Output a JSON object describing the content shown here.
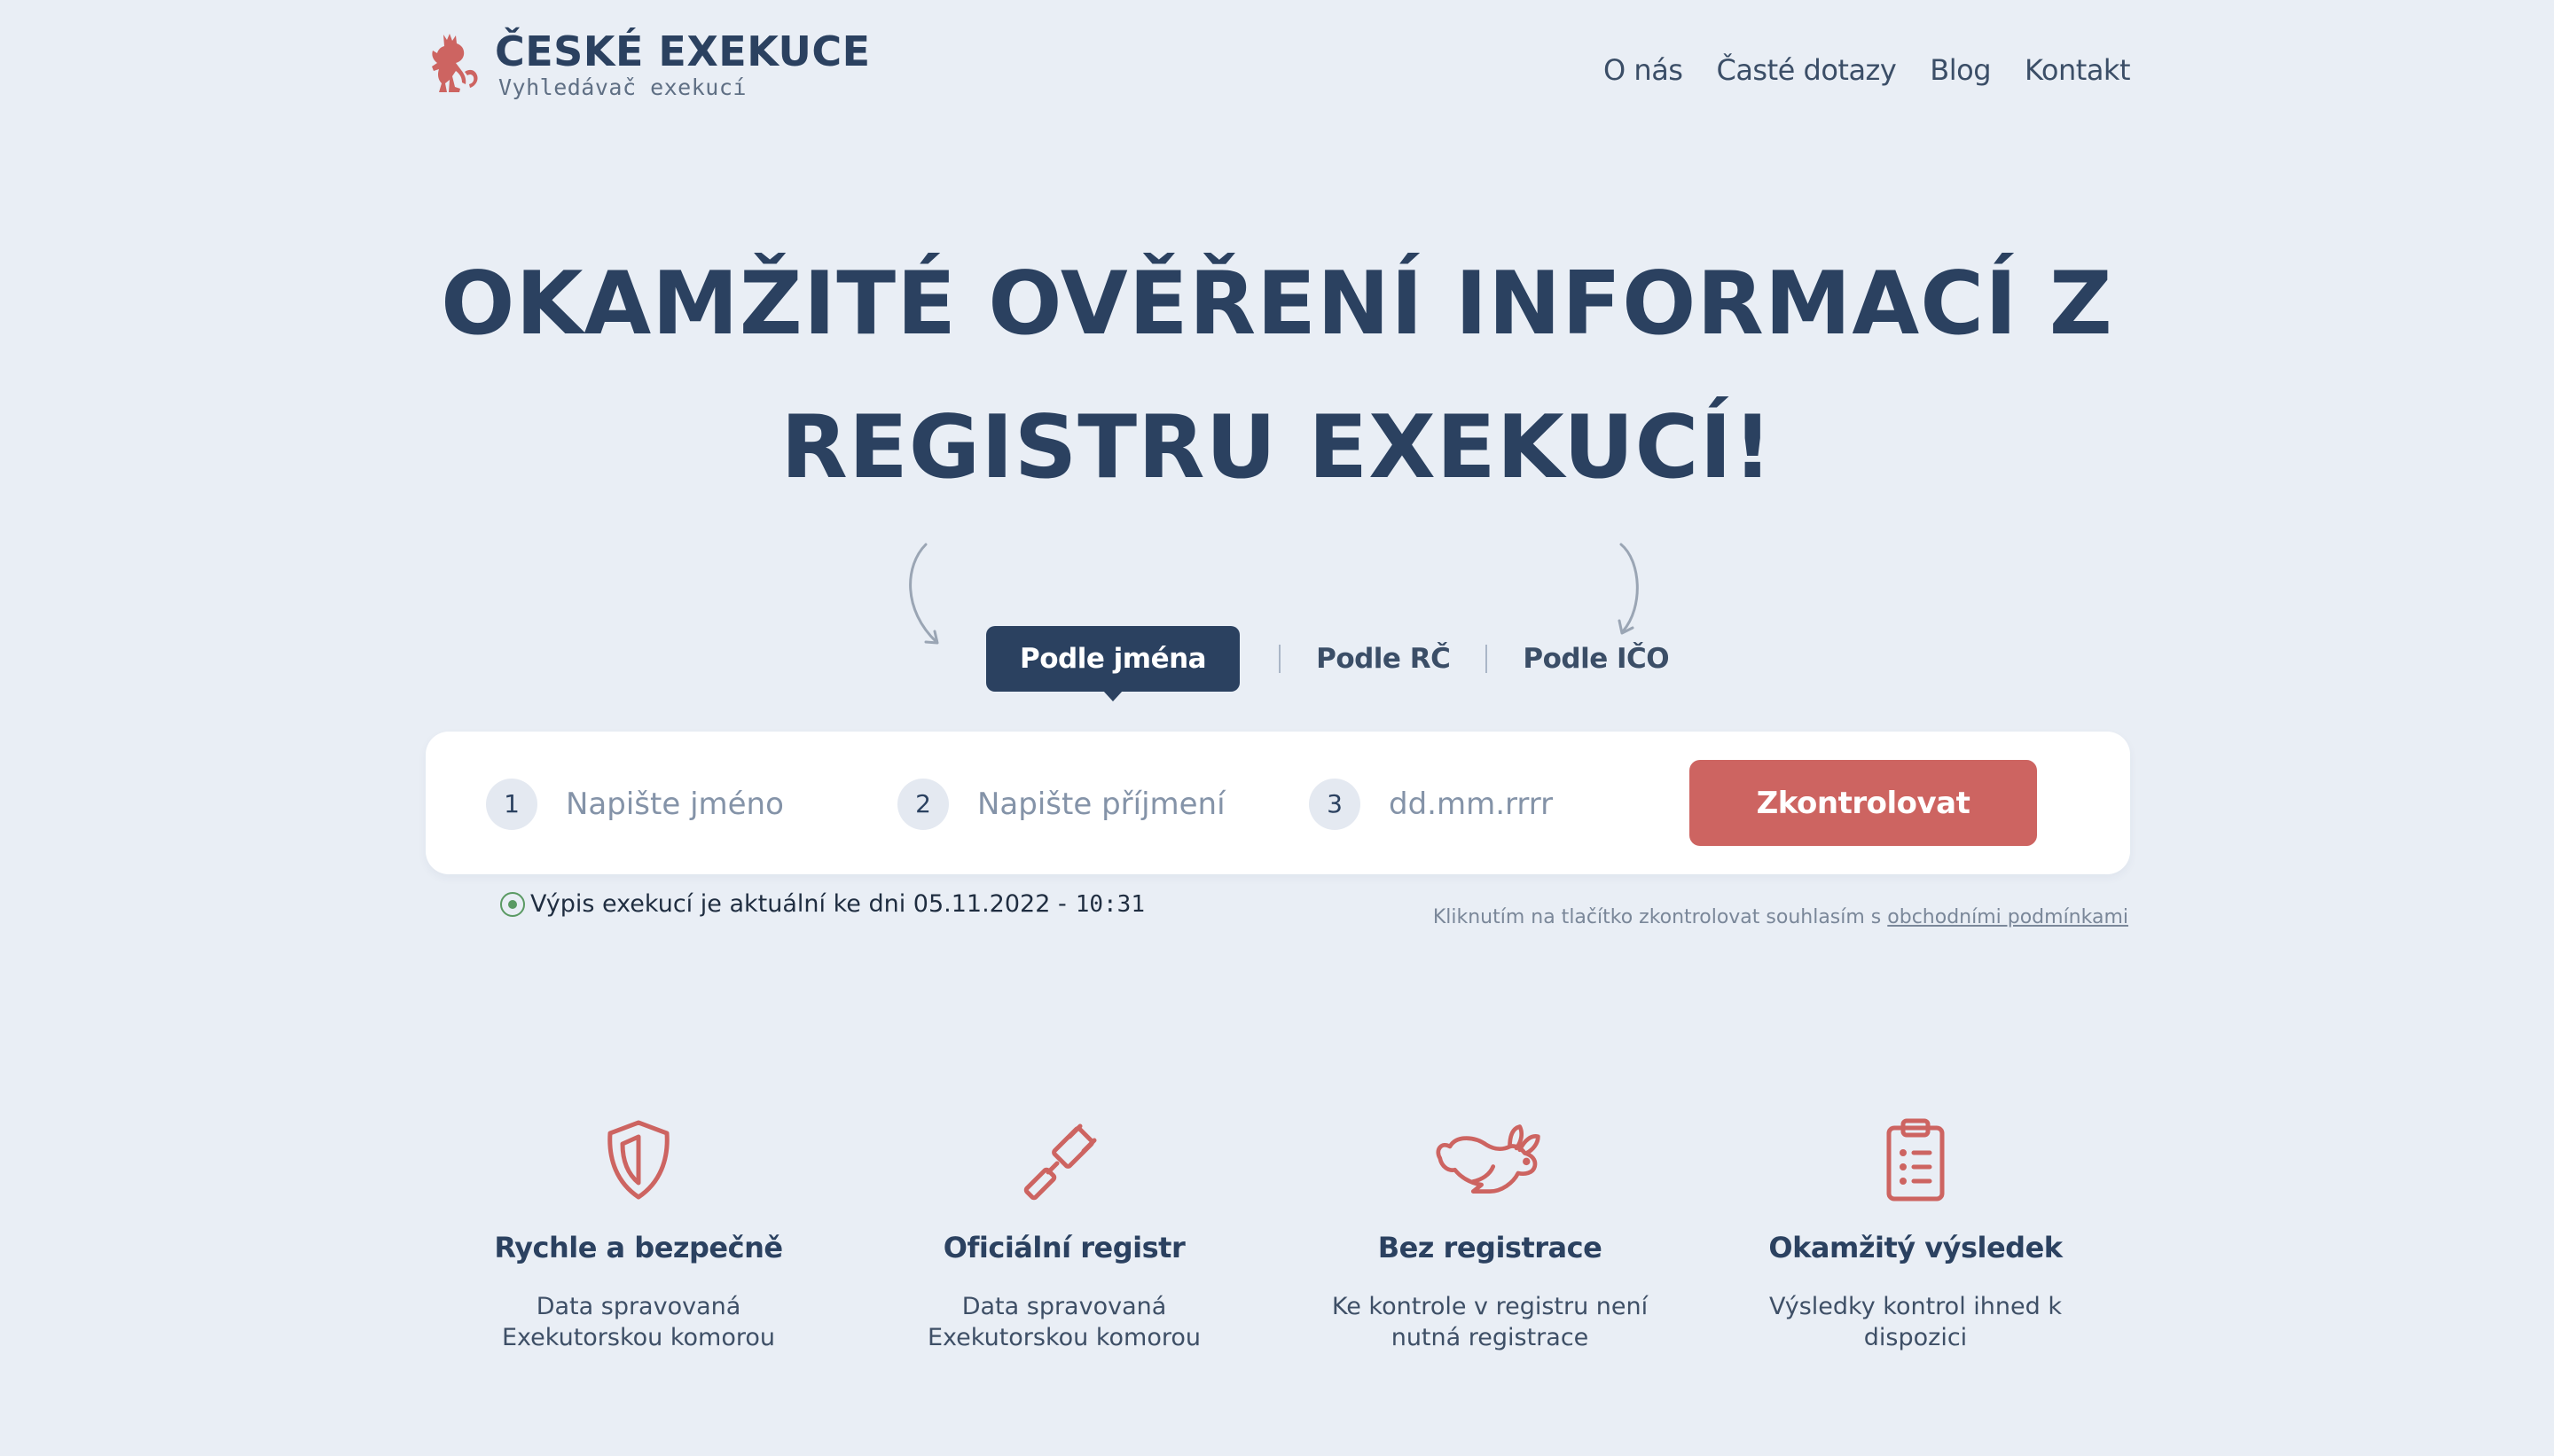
{
  "brand": {
    "title": "ČESKÉ EXEKUCE",
    "subtitle": "Vyhledávač exekucí",
    "accent": "#cd6461",
    "primary": "#2b4160"
  },
  "nav": {
    "items": [
      "O nás",
      "Časté dotazy",
      "Blog",
      "Kontakt"
    ]
  },
  "hero": {
    "line1": "OKAMŽITÉ OVĚŘENÍ INFORMACÍ Z",
    "line2": "REGISTRU EXEKUCÍ!"
  },
  "tabs": {
    "active": "Podle jména",
    "items": [
      "Podle RČ",
      "Podle IČO"
    ]
  },
  "search": {
    "fields": [
      {
        "num": "1",
        "placeholder": "Napište jméno",
        "value": ""
      },
      {
        "num": "2",
        "placeholder": "Napište příjmení",
        "value": ""
      },
      {
        "num": "3",
        "placeholder": "dd.mm.rrrr",
        "value": ""
      }
    ],
    "button": "Zkontrolovat"
  },
  "status": {
    "text": "Výpis exekucí je aktuální ke dni 05.11.2022 -",
    "time": "10:31",
    "color": "#5a9a63"
  },
  "terms": {
    "text": "Kliknutím na tlačítko zkontrolovat souhlasím s ",
    "link": "obchodními podmínkami"
  },
  "features": [
    {
      "icon": "shield-icon",
      "title": "Rychle a bezpečně",
      "desc1": "Data spravovaná",
      "desc2": "Exekutorskou komorou"
    },
    {
      "icon": "gavel-icon",
      "title": "Oficiální registr",
      "desc1": "Data spravovaná",
      "desc2": "Exekutorskou komorou"
    },
    {
      "icon": "rabbit-icon",
      "title": "Bez registrace",
      "desc1": "Ke kontrole v registru není",
      "desc2": "nutná registrace"
    },
    {
      "icon": "clipboard-list-icon",
      "title": "Okamžitý výsledek",
      "desc1": "Výsledky kontrol ihned k",
      "desc2": "dispozici"
    }
  ]
}
